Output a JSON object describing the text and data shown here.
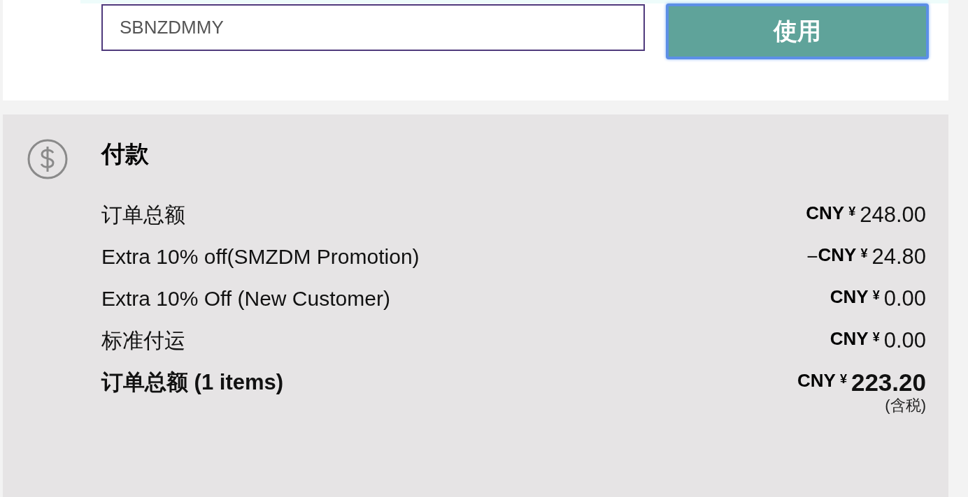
{
  "coupon": {
    "value": "SBNZDMMY",
    "button": "使用"
  },
  "payment": {
    "title": "付款",
    "rows": [
      {
        "label": "订单总额",
        "sign": null,
        "currency": "CNY",
        "symbol": "¥",
        "amount": "248.00",
        "total": false
      },
      {
        "label": "Extra 10% off(SMZDM Promotion)",
        "sign": "−",
        "currency": "CNY",
        "symbol": "¥",
        "amount": "24.80",
        "total": false
      },
      {
        "label": "Extra 10% Off (New Customer)",
        "sign": null,
        "currency": "CNY",
        "symbol": "¥",
        "amount": "0.00",
        "total": false
      },
      {
        "label": "标准付运",
        "sign": null,
        "currency": "CNY",
        "symbol": "¥",
        "amount": "0.00",
        "total": false
      },
      {
        "label": "订单总额 (1 items)",
        "sign": null,
        "currency": "CNY",
        "symbol": "¥",
        "amount": "223.20",
        "total": true,
        "note": "(含税)"
      }
    ]
  }
}
